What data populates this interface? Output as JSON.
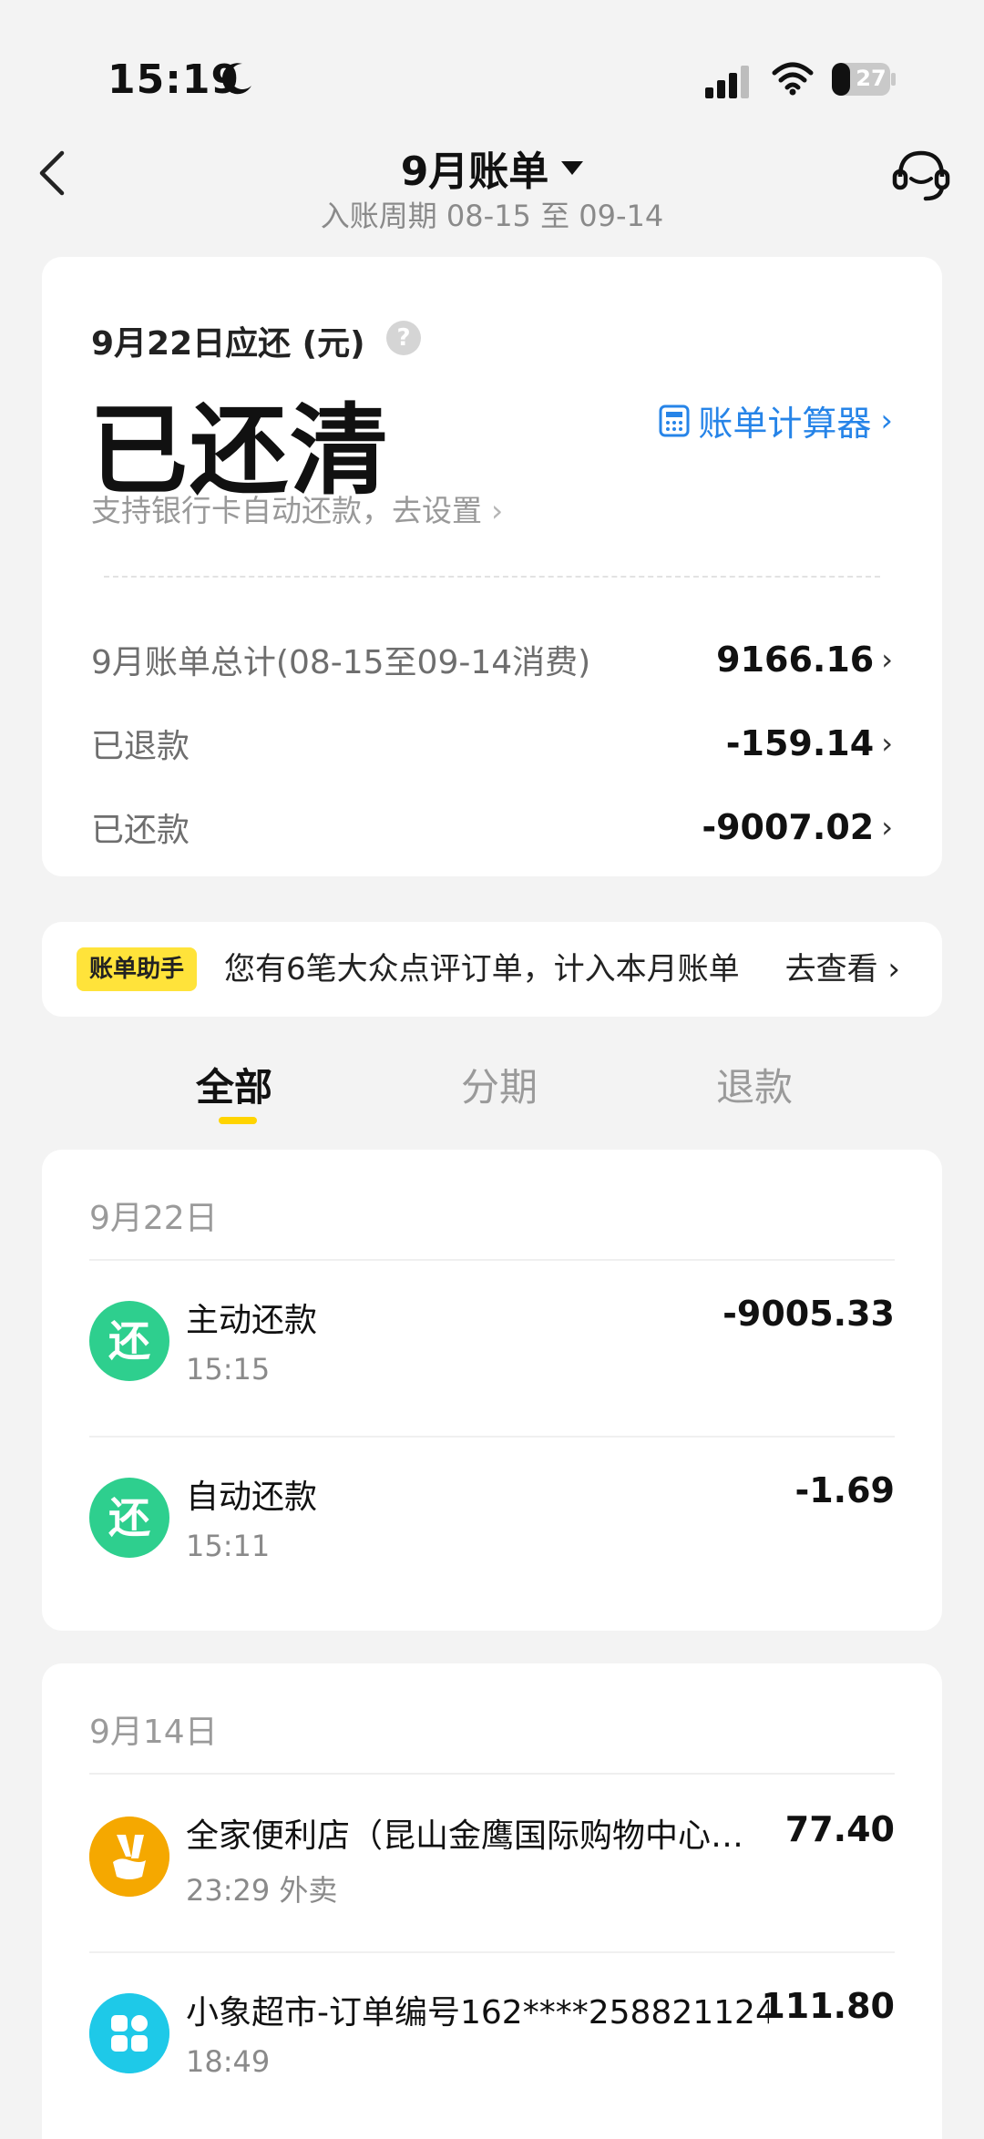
{
  "status_bar": {
    "time": "15:19",
    "battery_level": "27",
    "icons": [
      "moon-icon",
      "signal-icon",
      "wifi-icon",
      "battery-icon"
    ]
  },
  "header": {
    "title": "9月账单",
    "subtitle": "入账周期 08-15 至 09-14",
    "icons": [
      "back-arrow-icon",
      "chevron-down-icon",
      "customer-service-icon"
    ]
  },
  "summary": {
    "due_label": "9月22日应还 (元)",
    "help_glyph": "?",
    "status": "已还清",
    "calculator_label": "账单计算器",
    "calculator_arrow": "›",
    "auto_repay_link": "支持银行卡自动还款，去设置",
    "rows": [
      {
        "label": "9月账单总计(08-15至09-14消费)",
        "value": "9166.16"
      },
      {
        "label": "已退款",
        "value": "-159.14"
      },
      {
        "label": "已还款",
        "value": "-9007.02"
      }
    ],
    "accent_color": "#2684e8"
  },
  "assistant": {
    "badge": "账单助手",
    "message": "您有6笔大众点评订单，计入本月账单",
    "link": "去查看"
  },
  "tabs": [
    {
      "label": "全部",
      "active": true
    },
    {
      "label": "分期",
      "active": false
    },
    {
      "label": "退款",
      "active": false
    }
  ],
  "groups": [
    {
      "date": "9月22日",
      "transactions": [
        {
          "icon_glyph": "还",
          "icon": "repay-icon",
          "title": "主动还款",
          "sub": "15:15",
          "amount": "-9005.33"
        },
        {
          "icon_glyph": "还",
          "icon": "repay-icon",
          "title": "自动还款",
          "sub": "15:11",
          "amount": "-1.69"
        }
      ]
    },
    {
      "date": "9月14日",
      "transactions": [
        {
          "icon": "food-delivery-icon",
          "title": "全家便利店（昆山金鹰国际购物中心…",
          "sub": "23:29 外卖",
          "amount": "77.40"
        },
        {
          "icon": "supermarket-grid-icon",
          "title": "小象超市-订单编号162****258821124",
          "sub": "18:49",
          "amount": "111.80"
        }
      ]
    }
  ],
  "colors": {
    "repay_green": "#2ecf8e",
    "tab_underline": "#ffd400",
    "badge_yellow": "#ffe33a"
  }
}
